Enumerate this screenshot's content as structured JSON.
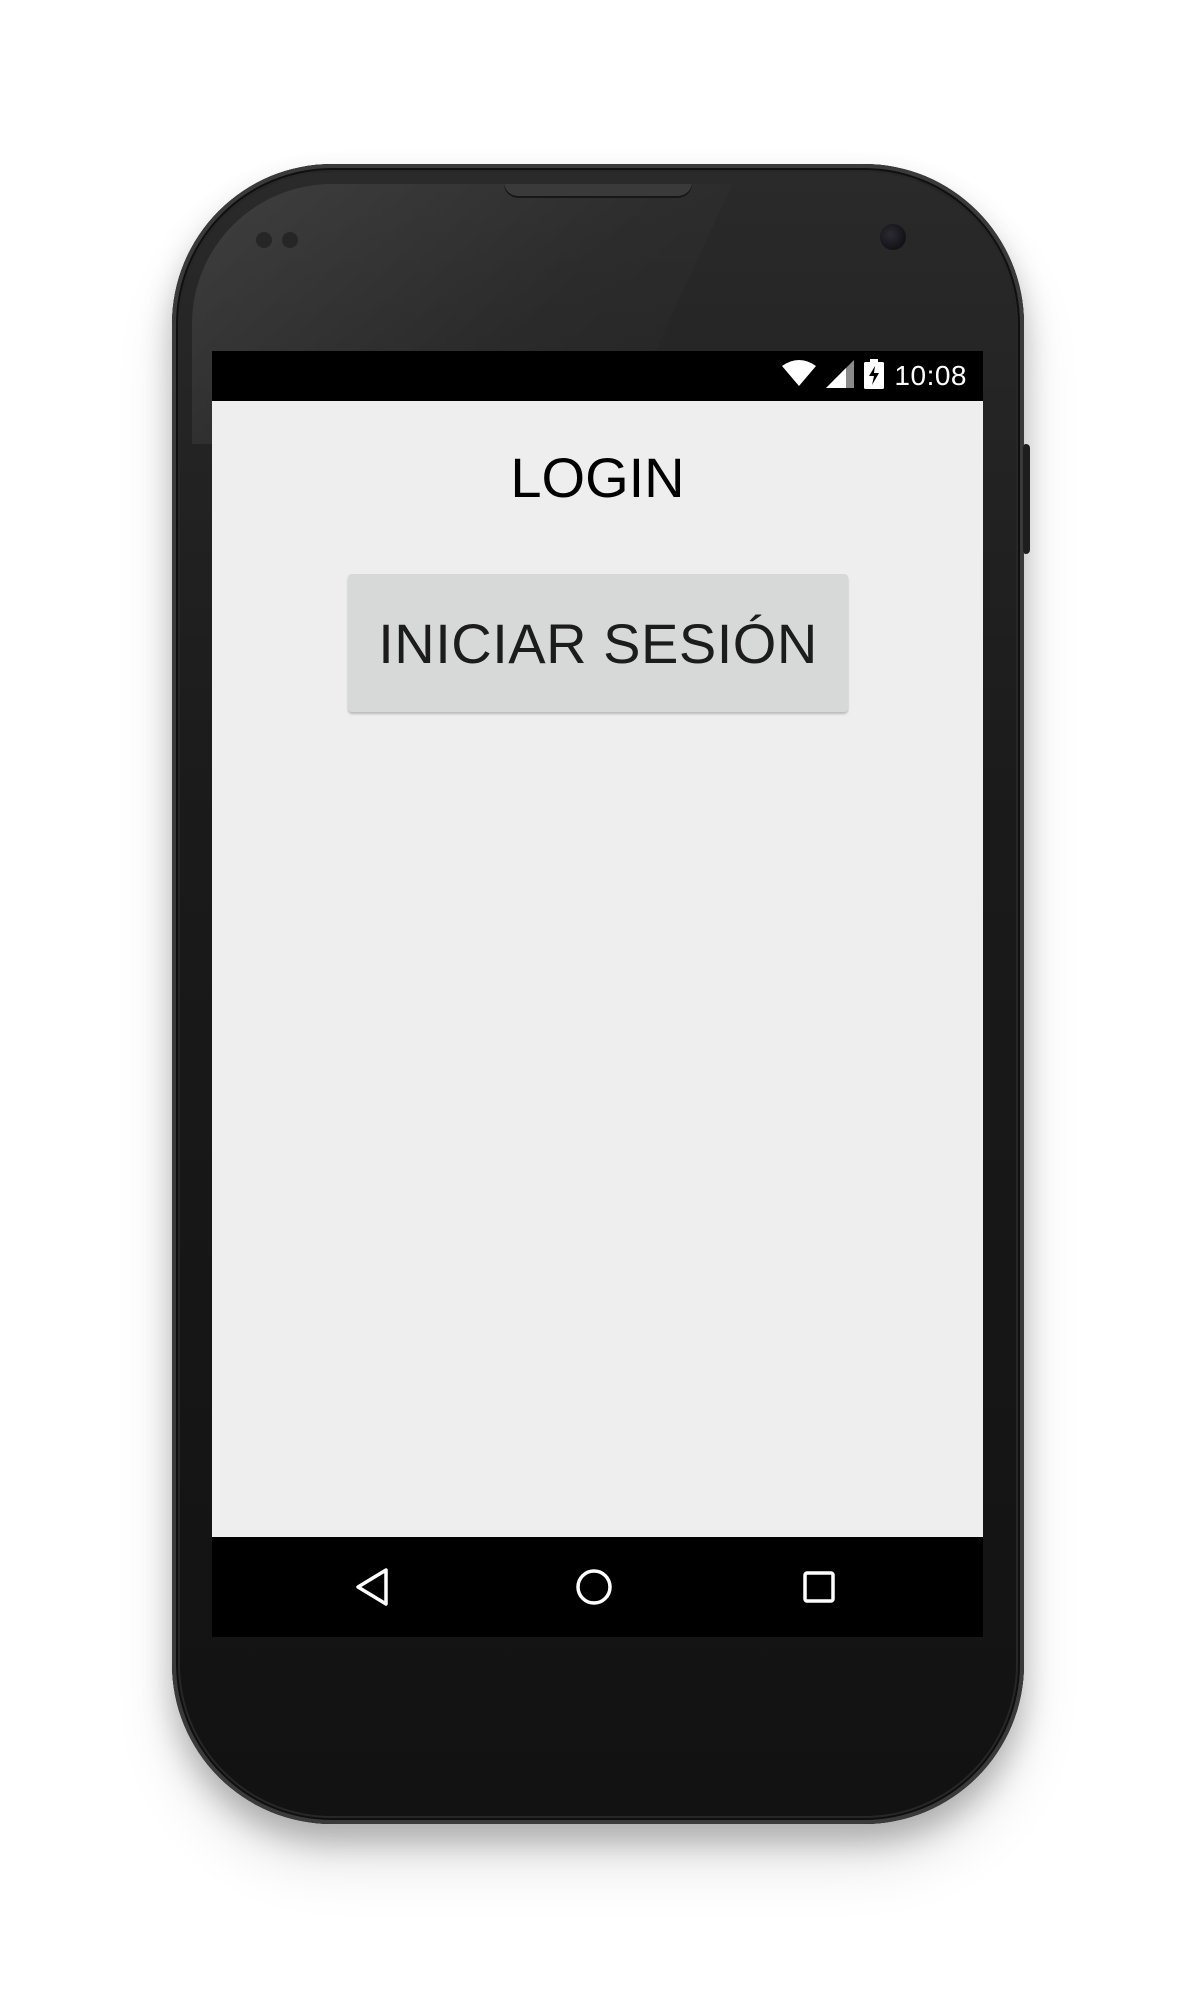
{
  "status_bar": {
    "time": "10:08",
    "icons": [
      "wifi-icon",
      "cellular-signal-icon",
      "battery-charging-icon"
    ]
  },
  "screen": {
    "title": "LOGIN",
    "primary_button_label": "INICIAR SESIÓN"
  },
  "navigation": {
    "icons": [
      "back-icon",
      "home-icon",
      "recents-icon"
    ]
  },
  "colors": {
    "screen_background": "#eeeeee",
    "button_background": "#d7d9d8",
    "status_bar_background": "#000000",
    "nav_bar_background": "#000000"
  }
}
